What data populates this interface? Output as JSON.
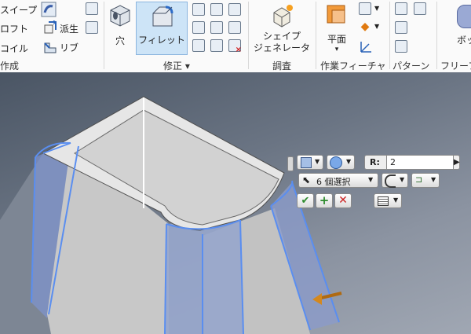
{
  "ribbon": {
    "create_panel": {
      "sweep_label": "スイープ",
      "loft_label": "ロフト",
      "coil_label": "コイル",
      "derive_label": "派生",
      "rib_label": "リブ",
      "panel_label": "作成"
    },
    "modify_panel": {
      "hole_label": "穴",
      "fillet_label": "フィレット",
      "panel_label": "修正 ▾"
    },
    "explore_panel": {
      "shape_gen_line1": "シェイプ",
      "shape_gen_line2": "ジェネレータ",
      "panel_label": "調査"
    },
    "work_features_panel": {
      "plane_label": "平面",
      "plane_arrow": "▾",
      "panel_label": "作業フィーチャ"
    },
    "pattern_panel": {
      "panel_label": "パターン"
    },
    "freeform_panel": {
      "box_label": "ボッ",
      "panel_label": "フリーフ"
    }
  },
  "mini_toolbar": {
    "radius_label": "R:",
    "radius_value": "2",
    "selection_text": "6 個選択"
  },
  "colors": {
    "ok": "#2e8b2e",
    "add": "#2e8b2e",
    "cancel": "#cc2222",
    "highlight": "#5a8ef0"
  }
}
